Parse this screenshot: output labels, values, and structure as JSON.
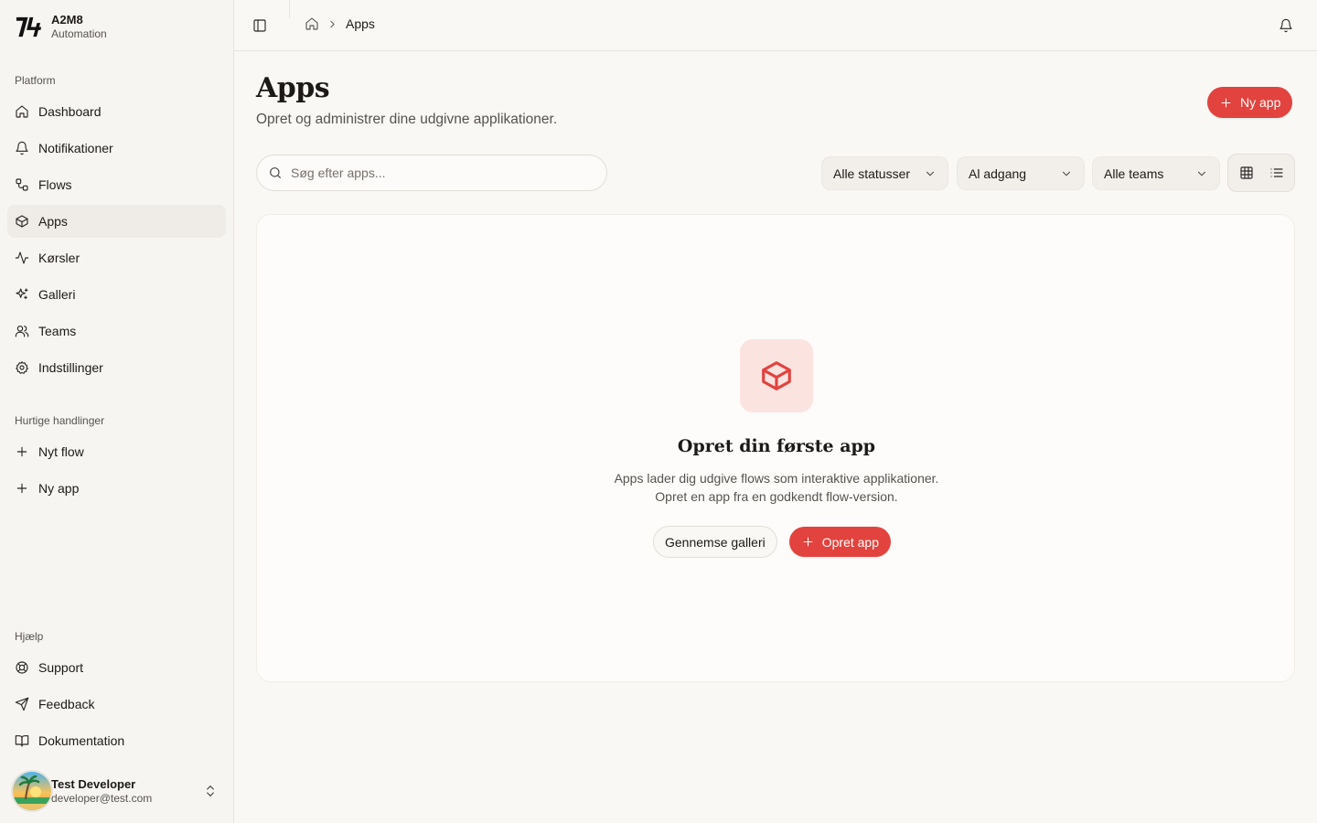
{
  "brand": {
    "name": "A2M8",
    "subtitle": "Automation"
  },
  "sidebar": {
    "platform_label": "Platform",
    "platform_items": [
      {
        "label": "Dashboard",
        "icon": "home-icon"
      },
      {
        "label": "Notifikationer",
        "icon": "bell-icon"
      },
      {
        "label": "Flows",
        "icon": "workflow-icon"
      },
      {
        "label": "Apps",
        "icon": "box-icon",
        "active": true
      },
      {
        "label": "Kørsler",
        "icon": "activity-icon"
      },
      {
        "label": "Galleri",
        "icon": "sparkles-icon"
      },
      {
        "label": "Teams",
        "icon": "users-icon"
      },
      {
        "label": "Indstillinger",
        "icon": "gear-icon"
      }
    ],
    "quick_label": "Hurtige handlinger",
    "quick_items": [
      {
        "label": "Nyt flow",
        "icon": "plus-icon"
      },
      {
        "label": "Ny app",
        "icon": "plus-icon"
      }
    ],
    "help_label": "Hjælp",
    "help_items": [
      {
        "label": "Support",
        "icon": "life-buoy-icon"
      },
      {
        "label": "Feedback",
        "icon": "send-icon"
      },
      {
        "label": "Dokumentation",
        "icon": "book-icon"
      }
    ],
    "user": {
      "name": "Test Developer",
      "email": "developer@test.com"
    }
  },
  "topbar": {
    "breadcrumb_current": "Apps"
  },
  "page": {
    "title": "Apps",
    "subtitle": "Opret og administrer dine udgivne applikationer.",
    "new_app_label": "Ny app"
  },
  "filters": {
    "search_placeholder": "Søg efter apps...",
    "status": "Alle statusser",
    "access": "Al adgang",
    "teams": "Alle teams"
  },
  "empty_state": {
    "title": "Opret din første app",
    "line1": "Apps lader dig udgive flows som interaktive applikationer.",
    "line2": "Opret en app fra en godkendt flow-version.",
    "browse_label": "Gennemse galleri",
    "create_label": "Opret app"
  },
  "colors": {
    "accent": "#e2433f",
    "accent_soft": "#fbe3e0",
    "background": "#faf8f5"
  }
}
